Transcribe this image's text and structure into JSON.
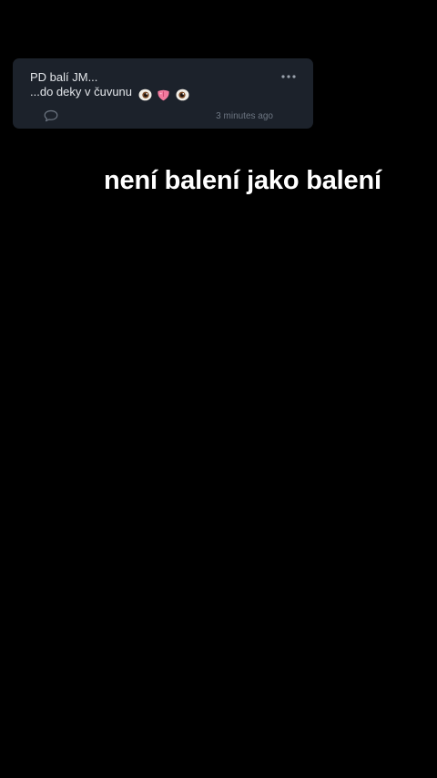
{
  "post": {
    "title": "PD balí JM...",
    "text": "...do deky v čuvunu",
    "emojis": [
      "eye-emoji",
      "tongue-emoji",
      "eye-emoji"
    ],
    "timestamp": "3 minutes ago",
    "more_icon": "ellipsis-icon",
    "comment_icon": "speech-bubble-icon"
  },
  "caption": "není balení jako balení",
  "colors": {
    "background": "#000000",
    "card": "#1c222b",
    "card_text": "#e3e6ea",
    "muted": "#6d7682",
    "caption": "#ffffff"
  }
}
